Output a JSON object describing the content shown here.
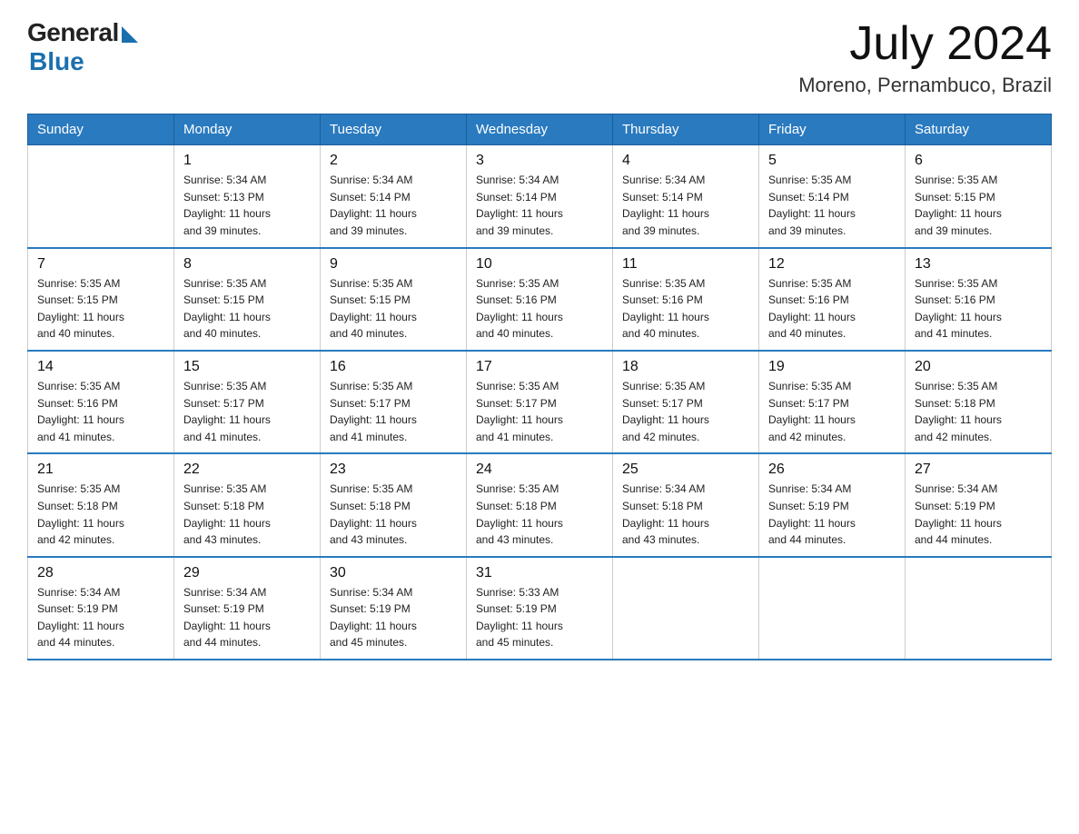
{
  "logo": {
    "general": "General",
    "blue": "Blue"
  },
  "title": {
    "month_year": "July 2024",
    "location": "Moreno, Pernambuco, Brazil"
  },
  "headers": [
    "Sunday",
    "Monday",
    "Tuesday",
    "Wednesday",
    "Thursday",
    "Friday",
    "Saturday"
  ],
  "weeks": [
    [
      {
        "day": "",
        "detail": ""
      },
      {
        "day": "1",
        "detail": "Sunrise: 5:34 AM\nSunset: 5:13 PM\nDaylight: 11 hours\nand 39 minutes."
      },
      {
        "day": "2",
        "detail": "Sunrise: 5:34 AM\nSunset: 5:14 PM\nDaylight: 11 hours\nand 39 minutes."
      },
      {
        "day": "3",
        "detail": "Sunrise: 5:34 AM\nSunset: 5:14 PM\nDaylight: 11 hours\nand 39 minutes."
      },
      {
        "day": "4",
        "detail": "Sunrise: 5:34 AM\nSunset: 5:14 PM\nDaylight: 11 hours\nand 39 minutes."
      },
      {
        "day": "5",
        "detail": "Sunrise: 5:35 AM\nSunset: 5:14 PM\nDaylight: 11 hours\nand 39 minutes."
      },
      {
        "day": "6",
        "detail": "Sunrise: 5:35 AM\nSunset: 5:15 PM\nDaylight: 11 hours\nand 39 minutes."
      }
    ],
    [
      {
        "day": "7",
        "detail": "Sunrise: 5:35 AM\nSunset: 5:15 PM\nDaylight: 11 hours\nand 40 minutes."
      },
      {
        "day": "8",
        "detail": "Sunrise: 5:35 AM\nSunset: 5:15 PM\nDaylight: 11 hours\nand 40 minutes."
      },
      {
        "day": "9",
        "detail": "Sunrise: 5:35 AM\nSunset: 5:15 PM\nDaylight: 11 hours\nand 40 minutes."
      },
      {
        "day": "10",
        "detail": "Sunrise: 5:35 AM\nSunset: 5:16 PM\nDaylight: 11 hours\nand 40 minutes."
      },
      {
        "day": "11",
        "detail": "Sunrise: 5:35 AM\nSunset: 5:16 PM\nDaylight: 11 hours\nand 40 minutes."
      },
      {
        "day": "12",
        "detail": "Sunrise: 5:35 AM\nSunset: 5:16 PM\nDaylight: 11 hours\nand 40 minutes."
      },
      {
        "day": "13",
        "detail": "Sunrise: 5:35 AM\nSunset: 5:16 PM\nDaylight: 11 hours\nand 41 minutes."
      }
    ],
    [
      {
        "day": "14",
        "detail": "Sunrise: 5:35 AM\nSunset: 5:16 PM\nDaylight: 11 hours\nand 41 minutes."
      },
      {
        "day": "15",
        "detail": "Sunrise: 5:35 AM\nSunset: 5:17 PM\nDaylight: 11 hours\nand 41 minutes."
      },
      {
        "day": "16",
        "detail": "Sunrise: 5:35 AM\nSunset: 5:17 PM\nDaylight: 11 hours\nand 41 minutes."
      },
      {
        "day": "17",
        "detail": "Sunrise: 5:35 AM\nSunset: 5:17 PM\nDaylight: 11 hours\nand 41 minutes."
      },
      {
        "day": "18",
        "detail": "Sunrise: 5:35 AM\nSunset: 5:17 PM\nDaylight: 11 hours\nand 42 minutes."
      },
      {
        "day": "19",
        "detail": "Sunrise: 5:35 AM\nSunset: 5:17 PM\nDaylight: 11 hours\nand 42 minutes."
      },
      {
        "day": "20",
        "detail": "Sunrise: 5:35 AM\nSunset: 5:18 PM\nDaylight: 11 hours\nand 42 minutes."
      }
    ],
    [
      {
        "day": "21",
        "detail": "Sunrise: 5:35 AM\nSunset: 5:18 PM\nDaylight: 11 hours\nand 42 minutes."
      },
      {
        "day": "22",
        "detail": "Sunrise: 5:35 AM\nSunset: 5:18 PM\nDaylight: 11 hours\nand 43 minutes."
      },
      {
        "day": "23",
        "detail": "Sunrise: 5:35 AM\nSunset: 5:18 PM\nDaylight: 11 hours\nand 43 minutes."
      },
      {
        "day": "24",
        "detail": "Sunrise: 5:35 AM\nSunset: 5:18 PM\nDaylight: 11 hours\nand 43 minutes."
      },
      {
        "day": "25",
        "detail": "Sunrise: 5:34 AM\nSunset: 5:18 PM\nDaylight: 11 hours\nand 43 minutes."
      },
      {
        "day": "26",
        "detail": "Sunrise: 5:34 AM\nSunset: 5:19 PM\nDaylight: 11 hours\nand 44 minutes."
      },
      {
        "day": "27",
        "detail": "Sunrise: 5:34 AM\nSunset: 5:19 PM\nDaylight: 11 hours\nand 44 minutes."
      }
    ],
    [
      {
        "day": "28",
        "detail": "Sunrise: 5:34 AM\nSunset: 5:19 PM\nDaylight: 11 hours\nand 44 minutes."
      },
      {
        "day": "29",
        "detail": "Sunrise: 5:34 AM\nSunset: 5:19 PM\nDaylight: 11 hours\nand 44 minutes."
      },
      {
        "day": "30",
        "detail": "Sunrise: 5:34 AM\nSunset: 5:19 PM\nDaylight: 11 hours\nand 45 minutes."
      },
      {
        "day": "31",
        "detail": "Sunrise: 5:33 AM\nSunset: 5:19 PM\nDaylight: 11 hours\nand 45 minutes."
      },
      {
        "day": "",
        "detail": ""
      },
      {
        "day": "",
        "detail": ""
      },
      {
        "day": "",
        "detail": ""
      }
    ]
  ]
}
